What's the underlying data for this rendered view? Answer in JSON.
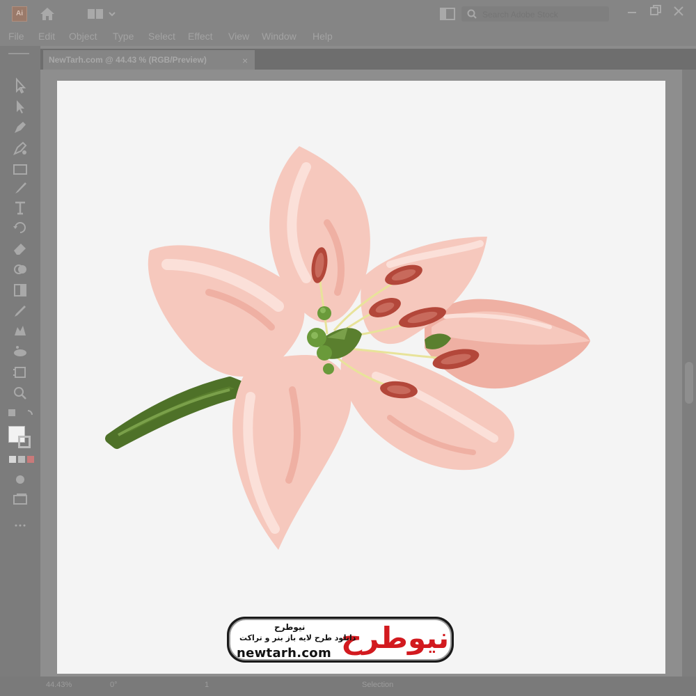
{
  "app": {
    "logo_text": "Ai"
  },
  "search": {
    "placeholder": "Search Adobe Stock"
  },
  "menu": [
    "File",
    "Edit",
    "Object",
    "Type",
    "Select",
    "Effect",
    "View",
    "Window",
    "Help"
  ],
  "document_tab": {
    "title": "NewTarh.com @ 44.43 % (RGB/Preview)",
    "close": "×"
  },
  "status": {
    "zoom": "44.43%",
    "angle": "0°",
    "page": "1",
    "mode": "Selection"
  },
  "watermark": {
    "brand": "نیوطرح",
    "name": "نیوطرح",
    "tagline": "دانلود طرح لایه باز بنر و تراکت",
    "url": "newtarh.com"
  },
  "colors": {
    "petal": "#f6c8bd",
    "petal_light": "#fbe0d9",
    "petal_shadow": "#efb0a3",
    "stem": "#5a7f2e",
    "anther": "#b3473a",
    "filament": "#e8e39a",
    "pistil": "#6a9a3a",
    "brand_red": "#d21a1f"
  },
  "icons": [
    "home-icon",
    "workspace-icon",
    "arrange-documents-icon",
    "search-icon"
  ]
}
